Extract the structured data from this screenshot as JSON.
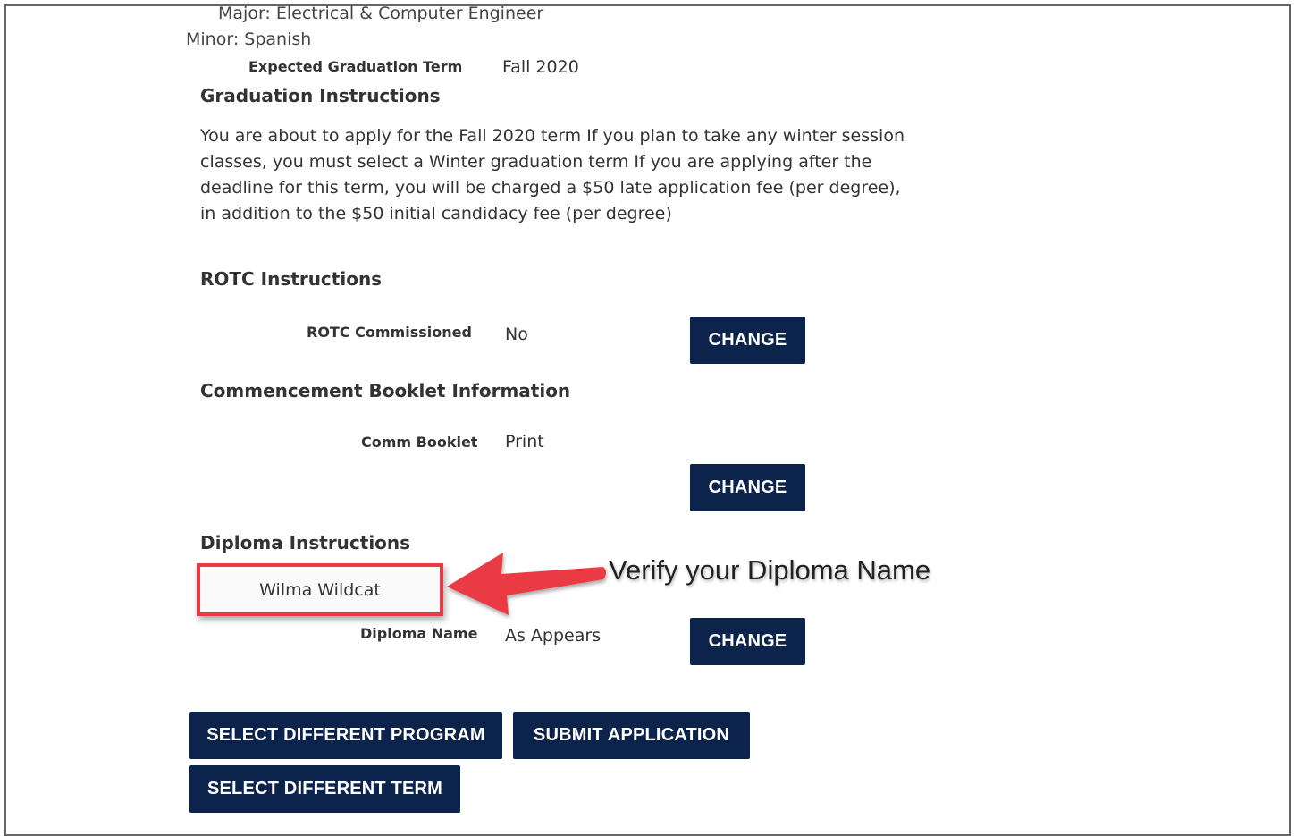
{
  "program": {
    "major": "Major: Electrical & Computer Engineer",
    "minor": "Minor: Spanish",
    "expected_term_label": "Expected Graduation Term",
    "expected_term_value": "Fall 2020"
  },
  "graduation": {
    "heading": "Graduation Instructions",
    "text": "You are about to apply for the Fall 2020 term If you plan to take any winter session classes, you must select a Winter graduation term If you are applying after the deadline for this term, you will be charged a $50 late application fee (per degree), in addition to the $50 initial candidacy fee (per degree)"
  },
  "rotc": {
    "heading": "ROTC Instructions",
    "label": "ROTC Commissioned",
    "value": "No",
    "change_label": "CHANGE"
  },
  "booklet": {
    "heading": "Commencement Booklet Information",
    "label": "Comm Booklet",
    "value": "Print",
    "change_label": "CHANGE"
  },
  "diploma": {
    "heading": "Diploma Instructions",
    "name": "Wilma Wildcat",
    "label": "Diploma Name",
    "value": "As Appears",
    "change_label": "CHANGE"
  },
  "annotation": {
    "callout": "Verify your Diploma Name",
    "highlight_color": "#ea3a45"
  },
  "actions": {
    "select_program": "SELECT DIFFERENT PROGRAM",
    "submit": "SUBMIT APPLICATION",
    "select_term": "SELECT DIFFERENT TERM"
  },
  "colors": {
    "button_bg": "#0c234b",
    "button_text": "#ffffff"
  }
}
